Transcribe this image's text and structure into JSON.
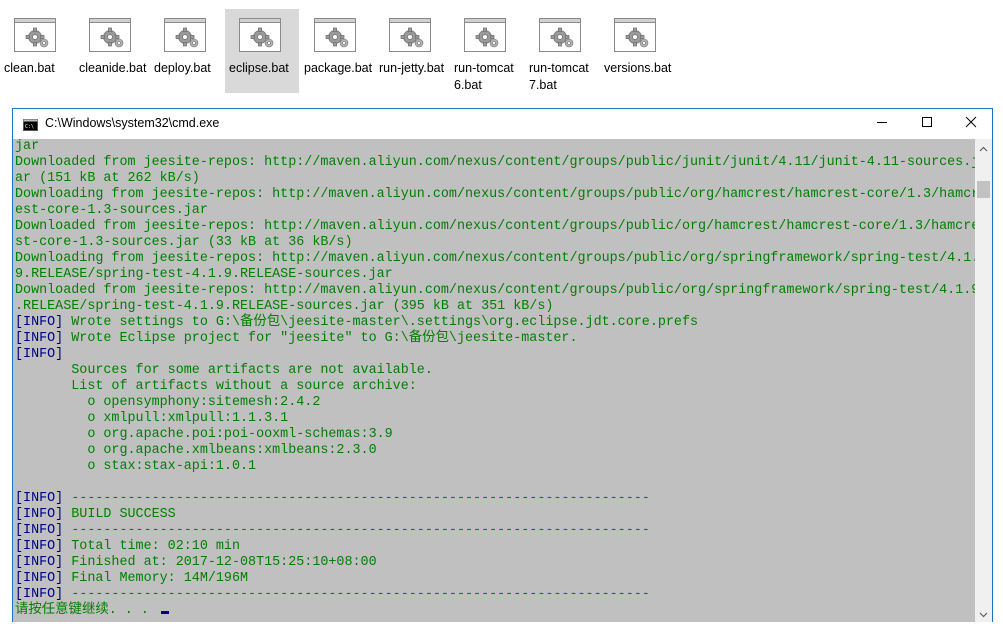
{
  "files": [
    {
      "name": "clean.bat",
      "selected": false
    },
    {
      "name": "cleanide.bat",
      "selected": false
    },
    {
      "name": "deploy.bat",
      "selected": false
    },
    {
      "name": "eclipse.bat",
      "selected": true
    },
    {
      "name": "package.bat",
      "selected": false
    },
    {
      "name": "run-jetty.bat",
      "selected": false
    },
    {
      "name": "run-tomcat6.bat",
      "selected": false
    },
    {
      "name": "run-tomcat7.bat",
      "selected": false
    },
    {
      "name": "versions.bat",
      "selected": false
    }
  ],
  "window": {
    "title": "C:\\Windows\\system32\\cmd.exe",
    "app_icon": "cmd-icon",
    "minimize_icon": "minimize-icon",
    "maximize_icon": "maximize-icon",
    "close_icon": "close-icon",
    "border_color": "#1a73c6"
  },
  "console": {
    "background": "#c0c0c0",
    "text_color": "#008000",
    "info_color": "#000080",
    "lines": [
      {
        "prefix": "",
        "text": "jar"
      },
      {
        "prefix": "",
        "text": "Downloaded from jeesite-repos: http://maven.aliyun.com/nexus/content/groups/public/junit/junit/4.11/junit-4.11-sources.j"
      },
      {
        "prefix": "",
        "text": "ar (151 kB at 262 kB/s)"
      },
      {
        "prefix": "",
        "text": "Downloading from jeesite-repos: http://maven.aliyun.com/nexus/content/groups/public/org/hamcrest/hamcrest-core/1.3/hamcr"
      },
      {
        "prefix": "",
        "text": "est-core-1.3-sources.jar"
      },
      {
        "prefix": "",
        "text": "Downloaded from jeesite-repos: http://maven.aliyun.com/nexus/content/groups/public/org/hamcrest/hamcrest-core/1.3/hamcre"
      },
      {
        "prefix": "",
        "text": "st-core-1.3-sources.jar (33 kB at 36 kB/s)"
      },
      {
        "prefix": "",
        "text": "Downloading from jeesite-repos: http://maven.aliyun.com/nexus/content/groups/public/org/springframework/spring-test/4.1."
      },
      {
        "prefix": "",
        "text": "9.RELEASE/spring-test-4.1.9.RELEASE-sources.jar"
      },
      {
        "prefix": "",
        "text": "Downloaded from jeesite-repos: http://maven.aliyun.com/nexus/content/groups/public/org/springframework/spring-test/4.1.9"
      },
      {
        "prefix": "",
        "text": ".RELEASE/spring-test-4.1.9.RELEASE-sources.jar (395 kB at 351 kB/s)"
      },
      {
        "prefix": "[INFO]",
        "text": " Wrote settings to G:\\备份包\\jeesite-master\\.settings\\org.eclipse.jdt.core.prefs"
      },
      {
        "prefix": "[INFO]",
        "text": " Wrote Eclipse project for \"jeesite\" to G:\\备份包\\jeesite-master."
      },
      {
        "prefix": "[INFO]",
        "text": ""
      },
      {
        "prefix": "",
        "text": "       Sources for some artifacts are not available."
      },
      {
        "prefix": "",
        "text": "       List of artifacts without a source archive:"
      },
      {
        "prefix": "",
        "text": "         o opensymphony:sitemesh:2.4.2"
      },
      {
        "prefix": "",
        "text": "         o xmlpull:xmlpull:1.1.3.1"
      },
      {
        "prefix": "",
        "text": "         o org.apache.poi:poi-ooxml-schemas:3.9"
      },
      {
        "prefix": "",
        "text": "         o org.apache.xmlbeans:xmlbeans:2.3.0"
      },
      {
        "prefix": "",
        "text": "         o stax:stax-api:1.0.1"
      },
      {
        "prefix": "",
        "text": ""
      },
      {
        "prefix": "[INFO]",
        "text": " ------------------------------------------------------------------------"
      },
      {
        "prefix": "[INFO]",
        "text": " BUILD SUCCESS"
      },
      {
        "prefix": "[INFO]",
        "text": " ------------------------------------------------------------------------"
      },
      {
        "prefix": "[INFO]",
        "text": " Total time: 02:10 min"
      },
      {
        "prefix": "[INFO]",
        "text": " Finished at: 2017-12-08T15:25:10+08:00"
      },
      {
        "prefix": "[INFO]",
        "text": " Final Memory: 14M/196M"
      },
      {
        "prefix": "[INFO]",
        "text": " ------------------------------------------------------------------------"
      },
      {
        "prefix": "",
        "text": "请按任意键继续. . . "
      }
    ]
  },
  "scrollbar": {
    "up_icon": "scroll-up-icon",
    "down_icon": "scroll-down-icon"
  }
}
